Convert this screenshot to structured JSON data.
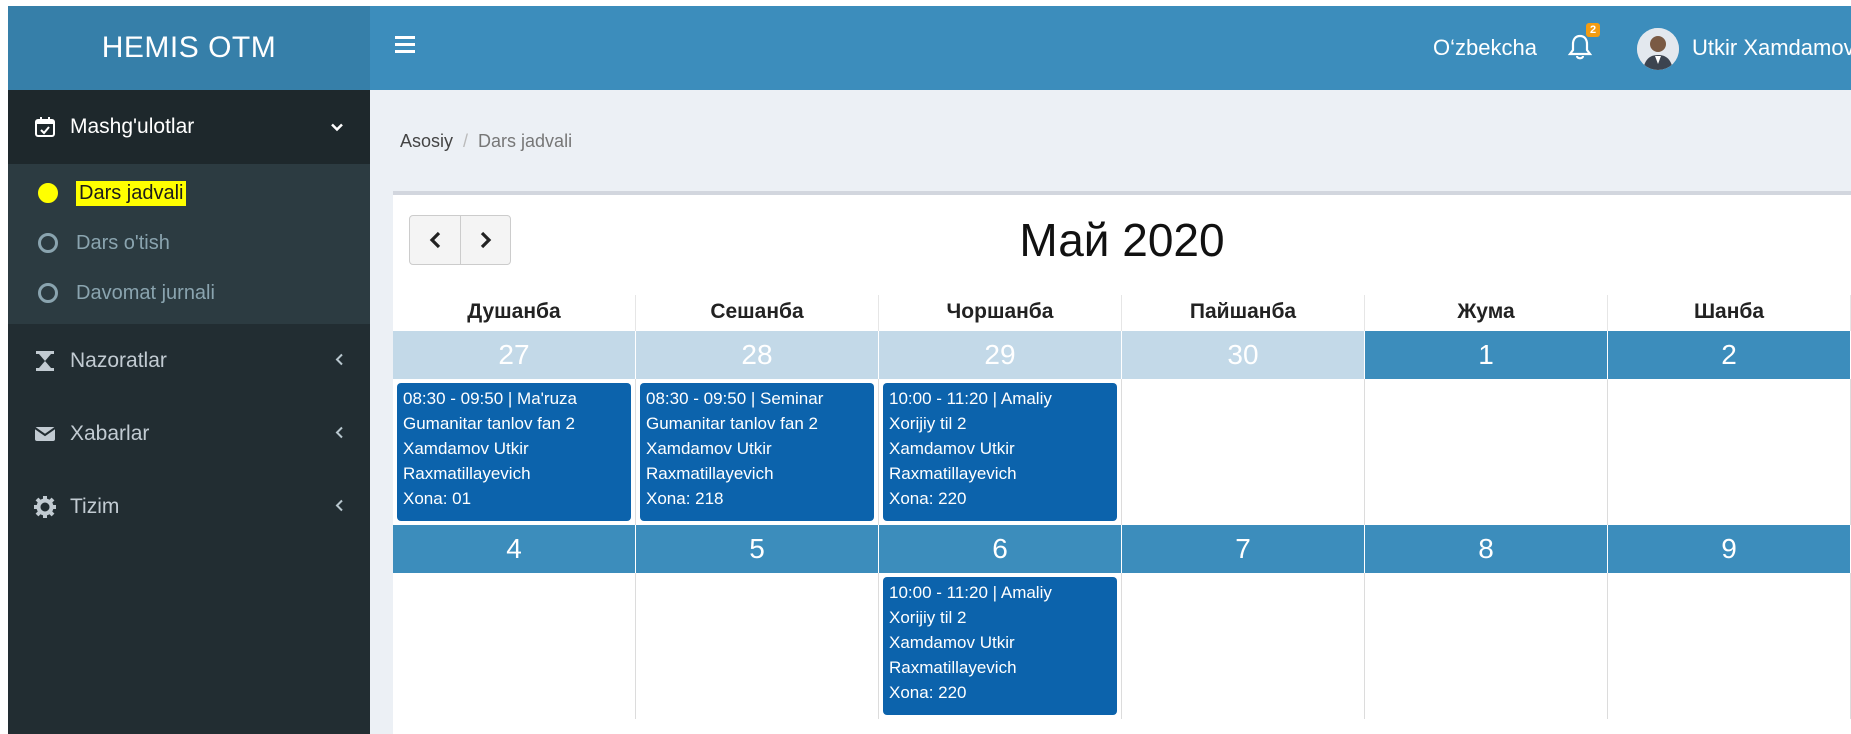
{
  "app": {
    "logo": "HEMIS OTM"
  },
  "header": {
    "language": "O‘zbekcha",
    "notification_count": "2",
    "user_name": "Utkir Xamdamov"
  },
  "sidebar": {
    "items": [
      {
        "label": "Mashg'ulotlar",
        "icon": "calendar-check-icon",
        "arrow": "chevron-down-icon"
      },
      {
        "label": "Nazoratlar",
        "icon": "hourglass-icon",
        "arrow": "chevron-left-icon"
      },
      {
        "label": "Xabarlar",
        "icon": "envelope-icon",
        "arrow": "chevron-left-icon"
      },
      {
        "label": "Tizim",
        "icon": "gear-icon",
        "arrow": "chevron-left-icon"
      }
    ],
    "subitems": [
      {
        "label": "Dars jadvali",
        "active": true
      },
      {
        "label": "Dars o'tish"
      },
      {
        "label": "Davomat jurnali"
      }
    ],
    "highlight_color": "#ffff00"
  },
  "breadcrumb": {
    "home": "Asosiy",
    "current": "Dars jadvali"
  },
  "calendar": {
    "title": "Май 2020",
    "weekdays": [
      "Душанба",
      "Сешанба",
      "Чоршанба",
      "Пайшанба",
      "Жума",
      "Шанба"
    ],
    "weeks": [
      {
        "days": [
          "27",
          "28",
          "29",
          "30",
          "1",
          "2"
        ],
        "events": [
          {
            "time": "08:30 - 09:50 | Ma'ruza",
            "subject": "Gumanitar tanlov fan 2",
            "teacher1": "Xamdamov Utkir",
            "teacher2": "Raxmatillayevich",
            "room": "Xona: 01"
          },
          {
            "time": "08:30 - 09:50 | Seminar",
            "subject": "Gumanitar tanlov fan 2",
            "teacher1": "Xamdamov Utkir",
            "teacher2": "Raxmatillayevich",
            "room": "Xona: 218"
          },
          {
            "time": "10:00 - 11:20 | Amaliy",
            "subject": "Xorijiy til 2",
            "teacher1": "Xamdamov Utkir",
            "teacher2": "Raxmatillayevich",
            "room": "Xona: 220"
          }
        ]
      },
      {
        "days": [
          "4",
          "5",
          "6",
          "7",
          "8",
          "9"
        ],
        "events": [
          {
            "time": "10:00 - 11:20 | Amaliy",
            "subject": "Xorijiy til 2",
            "teacher1": "Xamdamov Utkir",
            "teacher2": "Raxmatillayevich",
            "room": "Xona: 220"
          }
        ]
      }
    ],
    "colors": {
      "current_month": "#3c8dbc",
      "other_month": "#c3d9e8",
      "event": "#0c63ac"
    }
  }
}
